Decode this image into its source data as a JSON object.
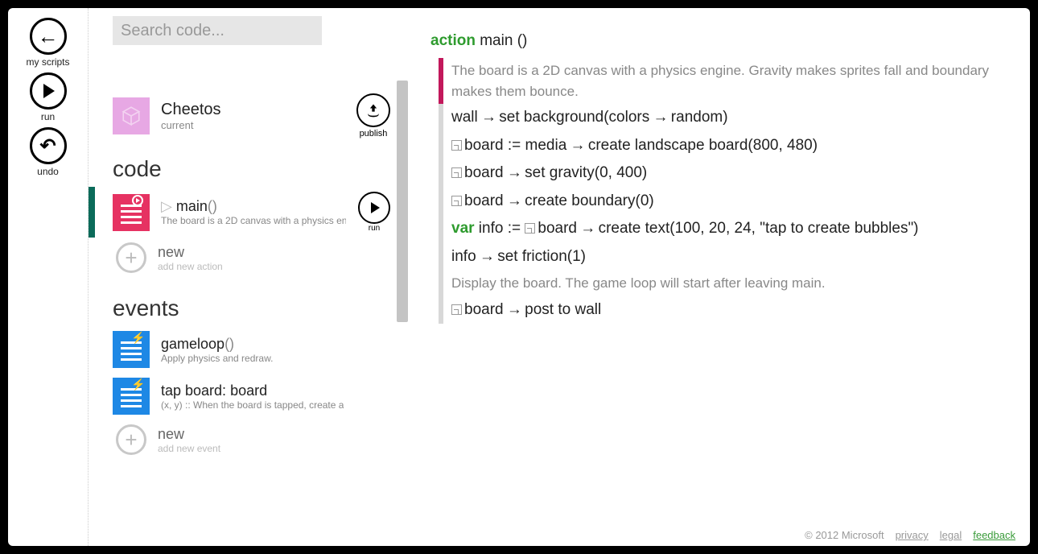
{
  "sidebar": {
    "back": "my scripts",
    "run": "run",
    "undo": "undo"
  },
  "search": {
    "placeholder": "Search code..."
  },
  "project": {
    "name": "Cheetos",
    "status": "current",
    "publish_label": "publish"
  },
  "sections": {
    "code_heading": "code",
    "events_heading": "events"
  },
  "code_items": {
    "main": {
      "name": "main",
      "parens": "()",
      "desc": "The board is a 2D canvas with a physics en",
      "run_label": "run"
    },
    "new": {
      "title": "new",
      "sub": "add new action"
    }
  },
  "event_items": {
    "gameloop": {
      "name": "gameloop",
      "parens": "()",
      "desc": "Apply physics and redraw."
    },
    "tap": {
      "name": "tap board: board",
      "desc": "(x, y) :: When the board is tapped, create a"
    },
    "new": {
      "title": "new",
      "sub": "add new event"
    }
  },
  "editor": {
    "header_kw": "action",
    "header_name": " main ()",
    "lines": {
      "c1": "The board is a 2D canvas with a physics engine. Gravity makes sprites fall and boundary makes them bounce.",
      "l1_a": "wall",
      "l1_b": " set background(colors",
      "l1_c": " random)",
      "l2_a": "board := media",
      "l2_b": " create landscape board(800, 480)",
      "l3_a": "board",
      "l3_b": " set gravity(0, 400)",
      "l4_a": "board",
      "l4_b": " create boundary(0)",
      "l5_kw": "var",
      "l5_a": " info := ",
      "l5_b": "board",
      "l5_c": " create text(100, 20, 24, \"tap to create bubbles\")",
      "l6_a": "info",
      "l6_b": " set friction(1)",
      "c2": "Display the board. The game loop will start after leaving main.",
      "l7_a": "board",
      "l7_b": " post to wall"
    }
  },
  "footer": {
    "copyright": "© 2012 Microsoft",
    "privacy": "privacy",
    "legal": "legal",
    "feedback": "feedback"
  }
}
